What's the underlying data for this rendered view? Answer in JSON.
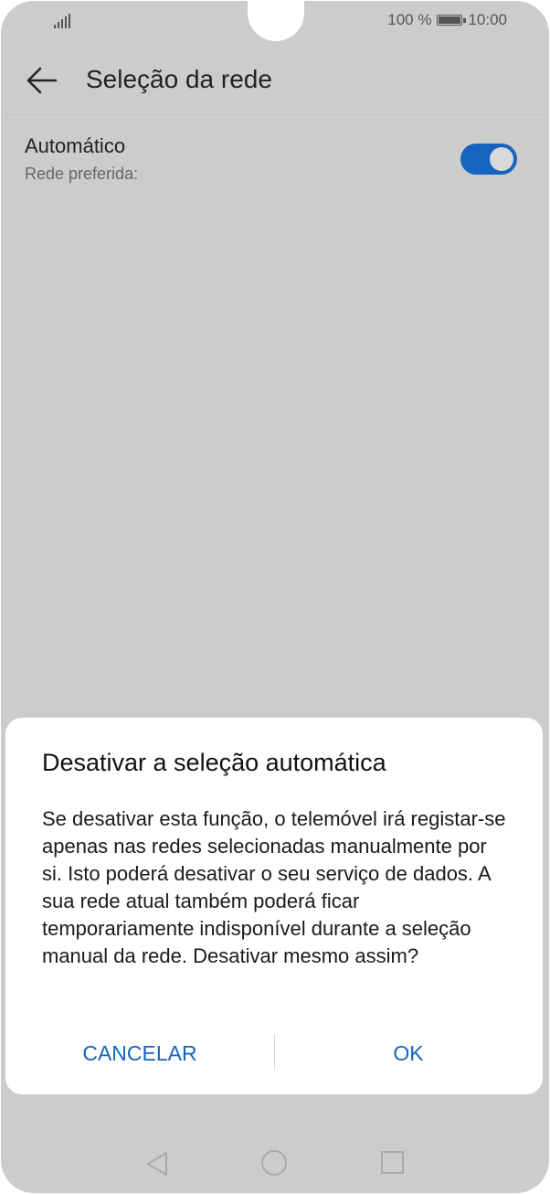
{
  "status_bar": {
    "battery_percent": "100 %",
    "time": "10:00",
    "icons": [
      "signal-icon",
      "battery-icon"
    ]
  },
  "app_bar": {
    "title": "Seleção da rede",
    "back_icon": "back-arrow-icon"
  },
  "setting": {
    "title": "Automático",
    "subtitle": "Rede preferida:",
    "toggle_on": true,
    "accent_color": "#1565c0"
  },
  "dialog": {
    "title": "Desativar a seleção automática",
    "body": "Se desativar esta função, o telemóvel irá registar-se apenas nas redes selecionadas manualmente por si. Isto poderá desativar o seu serviço de dados. A sua rede atual também poderá ficar temporariamente indisponível durante a seleção manual da rede. Desativar mesmo assim?",
    "cancel_label": "CANCELAR",
    "ok_label": "OK"
  },
  "nav_bar": {
    "icons": [
      "nav-back-icon",
      "nav-home-icon",
      "nav-recent-icon"
    ]
  }
}
